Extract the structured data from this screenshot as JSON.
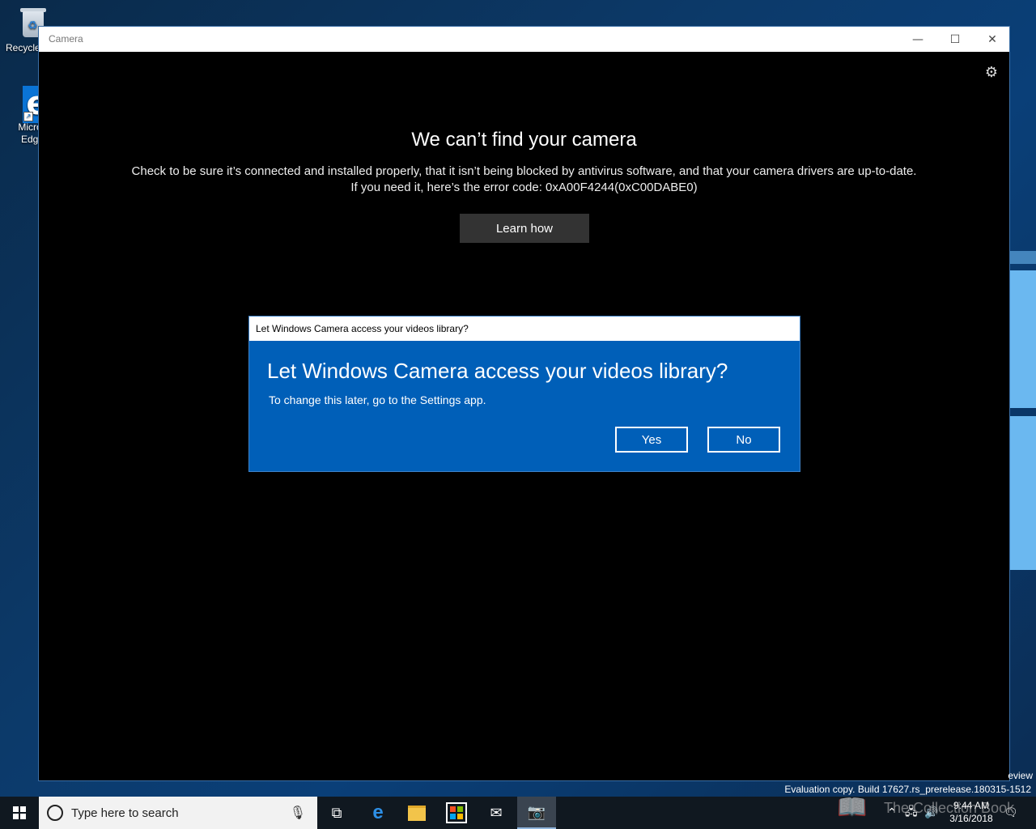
{
  "desktop": {
    "icons": [
      {
        "label": "Recycle"
      },
      {
        "label_line1": "Micros",
        "label_line2": "Edge"
      }
    ]
  },
  "window": {
    "title": "Camera",
    "controls": {
      "minimize": "—",
      "maximize": "☐",
      "close": "✕"
    },
    "settings_icon": "⚙",
    "heading": "We can’t find your camera",
    "message_line1": "Check to be sure it’s connected and installed properly, that it isn’t being blocked by antivirus software, and that your camera drivers are up-to-date.",
    "message_line2": "If you need it, here’s the error code: 0xA00F4244(0xC00DABE0)",
    "learn_button": "Learn how"
  },
  "dialog": {
    "titlebar": "Let Windows Camera access your videos library?",
    "heading": "Let Windows Camera access your videos library?",
    "subtext": "To change this later, go to the Settings app.",
    "yes": "Yes",
    "no": "No",
    "accent": "#005fb8"
  },
  "overlay": {
    "preview_fragment": "eview",
    "evaluation": "Evaluation copy. Build 17627.rs_prerelease.180315-1512"
  },
  "taskbar": {
    "search_placeholder": "Type here to search",
    "time": "9:44 AM",
    "date": "3/16/2018",
    "watermark": "The Collection Book"
  }
}
